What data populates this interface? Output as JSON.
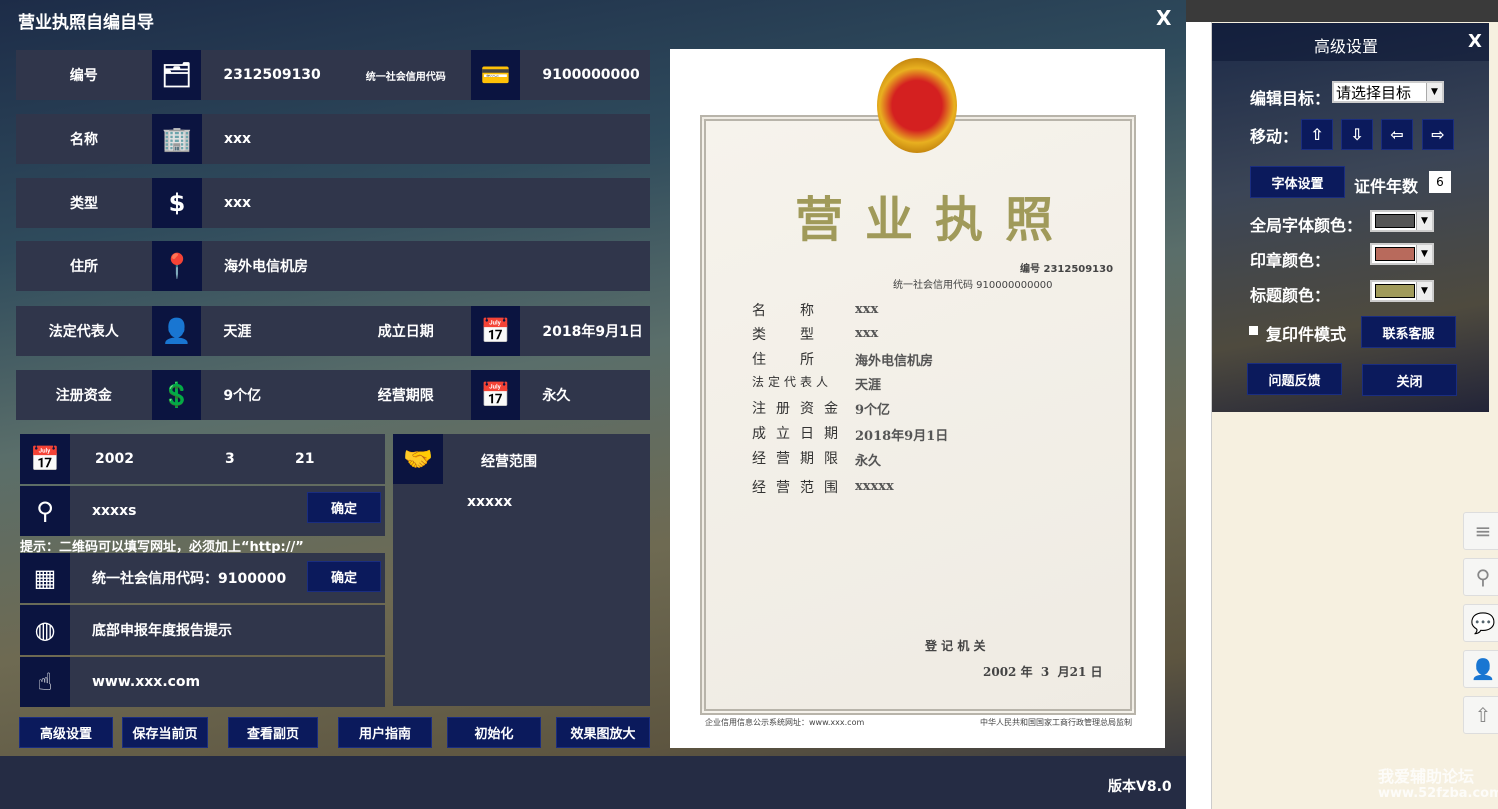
{
  "window": {
    "title": "营业执照自编自导",
    "close": "X",
    "version": "版本V8.0"
  },
  "rows": [
    {
      "label": "编号",
      "icon": "folder-icon",
      "value": "2312509130",
      "label2": "统一社会信用代码",
      "icon2": "card-icon",
      "value2": "9100000000"
    },
    {
      "label": "名称",
      "icon": "building-icon",
      "value": "xxx"
    },
    {
      "label": "类型",
      "icon": "money-hand-icon",
      "value": "xxx"
    },
    {
      "label": "住所",
      "icon": "location-pin-icon",
      "value": "海外电信机房"
    },
    {
      "label": "法定代表人",
      "icon": "person-icon",
      "value": "天涯",
      "label2": "成立日期",
      "icon2": "calendar-icon",
      "value2": "2018年9月1日"
    },
    {
      "label": "注册资金",
      "icon": "dollar-icon",
      "value": "9个亿",
      "label2": "经营期限",
      "icon2": "calendar-icon",
      "value2": "永久"
    }
  ],
  "issue_date": {
    "year": "2002",
    "month": "3",
    "day": "21"
  },
  "stamp": {
    "value": "xxxxs",
    "confirm": "确定"
  },
  "hint": "提示：二维码可以填写网址，必须加上“http://”",
  "qr": {
    "value": "统一社会信用代码：9100000",
    "confirm": "确定"
  },
  "annual": "底部申报年度报告提示",
  "website": "www.xxx.com",
  "scope": {
    "label": "经营范围",
    "value": "xxxxx"
  },
  "buttons": [
    "高级设置",
    "保存当前页",
    "查看副页",
    "用户指南",
    "初始化",
    "效果图放大"
  ],
  "cert": {
    "title": "营业执照",
    "number": "编号 2312509130",
    "credit": "统一社会信用代码 910000000000",
    "fields": [
      {
        "k": "名　称",
        "v": "xxx"
      },
      {
        "k": "类　型",
        "v": "xxx"
      },
      {
        "k": "住　所",
        "v": "海外电信机房"
      },
      {
        "k": "法定代表人",
        "v": "天涯"
      },
      {
        "k": "注册资金",
        "v": "9个亿"
      },
      {
        "k": "成立日期",
        "v": "2018年9月1日"
      },
      {
        "k": "经营期限",
        "v": "永久"
      },
      {
        "k": "经营范围",
        "v": "xxxxx"
      }
    ],
    "authority": "登 记 机 关",
    "date": "2002 年  3  月21 日",
    "footer_left": "企业信用信息公示系统网址：www.xxx.com",
    "footer_right": "中华人民共和国国家工商行政管理总局监制"
  },
  "advanced": {
    "title": "高级设置",
    "close": "X",
    "edit_target_label": "编辑目标：",
    "edit_target_value": "请选择目标",
    "move_label": "移动：",
    "font_btn": "字体设置",
    "years_label": "证件年数",
    "years_value": "6",
    "global_color_label": "全局字体颜色：",
    "global_color": "#555555",
    "seal_color_label": "印章颜色：",
    "seal_color": "#b86a5c",
    "title_color_label": "标题颜色：",
    "title_color": "#a09a5a",
    "copy_mode": "复印件模式",
    "contact": "联系客服",
    "feedback": "问题反馈",
    "close_btn": "关闭"
  },
  "watermark": {
    "line1": "我爱辅助论坛",
    "line2": "www.52fzba.com"
  }
}
